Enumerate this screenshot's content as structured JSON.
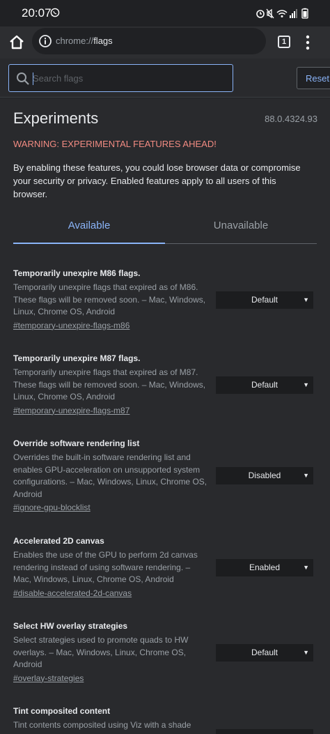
{
  "status_bar": {
    "time": "20:07"
  },
  "toolbar": {
    "url_scheme": "chrome://",
    "url_host": "flags",
    "tab_count": "1"
  },
  "search": {
    "placeholder": "Search flags",
    "reset_label": "Reset"
  },
  "page": {
    "title": "Experiments",
    "version": "88.0.4324.93",
    "warning": "WARNING: EXPERIMENTAL FEATURES AHEAD!",
    "intro": "By enabling these features, you could lose browser data or compromise your security or privacy. Enabled features apply to all users of this browser."
  },
  "tabs": [
    {
      "label": "Available",
      "active": true
    },
    {
      "label": "Unavailable",
      "active": false
    }
  ],
  "flags": [
    {
      "name": "Temporarily unexpire M86 flags.",
      "description": "Temporarily unexpire flags that expired as of M86. These flags will be removed soon. – Mac, Windows, Linux, Chrome OS, Android",
      "link": "#temporary-unexpire-flags-m86",
      "value": "Default"
    },
    {
      "name": "Temporarily unexpire M87 flags.",
      "description": "Temporarily unexpire flags that expired as of M87. These flags will be removed soon. – Mac, Windows, Linux, Chrome OS, Android",
      "link": "#temporary-unexpire-flags-m87",
      "value": "Default"
    },
    {
      "name": "Override software rendering list",
      "description": "Overrides the built-in software rendering list and enables GPU-acceleration on unsupported system configurations. – Mac, Windows, Linux, Chrome OS, Android",
      "link": "#ignore-gpu-blocklist",
      "value": "Disabled"
    },
    {
      "name": "Accelerated 2D canvas",
      "description": "Enables the use of the GPU to perform 2d canvas rendering instead of using software rendering. – Mac, Windows, Linux, Chrome OS, Android",
      "link": "#disable-accelerated-2d-canvas",
      "value": "Enabled"
    },
    {
      "name": "Select HW overlay strategies",
      "description": "Select strategies used to promote quads to HW overlays. – Mac, Windows, Linux, Chrome OS, Android",
      "link": "#overlay-strategies",
      "value": "Default"
    },
    {
      "name": "Tint composited content",
      "description": "Tint contents composited using Viz with a shade",
      "link": "",
      "value": ""
    }
  ],
  "colors": {
    "accent": "#8ab4f8",
    "warning": "#f28b82",
    "background": "#292a2d"
  }
}
